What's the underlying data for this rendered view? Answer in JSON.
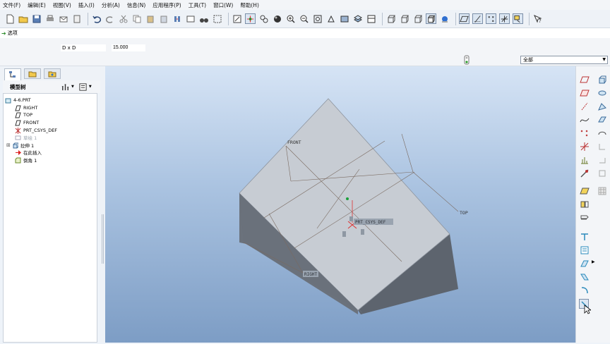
{
  "menu": [
    "文件(F)",
    "编辑(E)",
    "视图(V)",
    "插入(I)",
    "分析(A)",
    "信息(N)",
    "应用程序(P)",
    "工具(T)",
    "窗口(W)",
    "帮助(H)"
  ],
  "status": {
    "message": "选项"
  },
  "dashboard": {
    "dimension_label": "D x D",
    "dimension_value": "15.000"
  },
  "filter": {
    "selected": "全部"
  },
  "model_tree": {
    "title": "模型树",
    "items": [
      {
        "label": "4-6.PRT",
        "icon": "part-icon"
      },
      {
        "label": "RIGHT",
        "icon": "datum-plane-icon"
      },
      {
        "label": "TOP",
        "icon": "datum-plane-icon"
      },
      {
        "label": "FRONT",
        "icon": "datum-plane-icon"
      },
      {
        "label": "PRT_CSYS_DEF",
        "icon": "csys-icon"
      },
      {
        "label": "草绘 1",
        "icon": "sketch-icon"
      },
      {
        "label": "拉伸 1",
        "icon": "extrude-icon"
      },
      {
        "label": "在此插入",
        "icon": "insert-arrow-icon"
      },
      {
        "label": "倒角 1",
        "icon": "chamfer-icon"
      }
    ]
  },
  "viewport_labels": {
    "front": "FRONT",
    "top": "TOP",
    "csys": "PRT_CSYS_DEF",
    "right": "RIGHT"
  },
  "colors": {
    "viewport_top": "#d6e4f5",
    "viewport_bottom": "#7d9dc5",
    "part_face": "#c9ced6",
    "part_side": "#6f7680",
    "accent": "#2a8a2a"
  }
}
